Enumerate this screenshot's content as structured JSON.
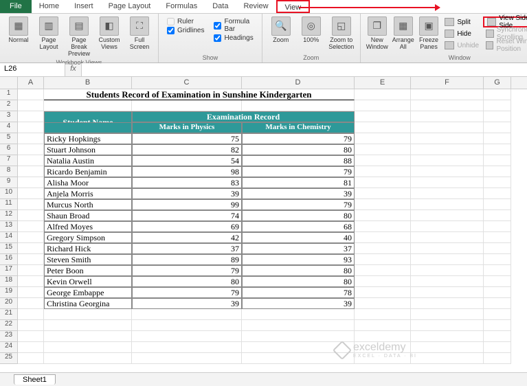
{
  "tabs": {
    "file": "File",
    "home": "Home",
    "insert": "Insert",
    "pagelayout": "Page Layout",
    "formulas": "Formulas",
    "data": "Data",
    "review": "Review",
    "view": "View"
  },
  "ribbon": {
    "views": {
      "normal": "Normal",
      "page": "Page Layout",
      "break": "Page Break Preview",
      "custom": "Custom Views",
      "full": "Full Screen",
      "group": "Workbook Views"
    },
    "show": {
      "ruler": "Ruler",
      "formulabar": "Formula Bar",
      "gridlines": "Gridlines",
      "headings": "Headings",
      "group": "Show"
    },
    "zoom": {
      "zoom": "Zoom",
      "p100": "100%",
      "sel": "Zoom to Selection",
      "group": "Zoom"
    },
    "window": {
      "new": "New Window",
      "arrange": "Arrange All",
      "freeze": "Freeze Panes",
      "split": "Split",
      "hide": "Hide",
      "unhide": "Unhide",
      "sidebyside": "View Side by Side",
      "sync": "Synchronous Scrolling",
      "reset": "Reset Window Position",
      "group": "Window"
    }
  },
  "namebox": "L26",
  "cols": [
    "A",
    "B",
    "C",
    "D",
    "E",
    "F",
    "G"
  ],
  "title": "Students Record of Examination in Sunshine Kindergarten",
  "headers": {
    "student": "Student Name",
    "exam": "Examination Record",
    "phys": "Marks in Physics",
    "chem": "Marks in Chemistry"
  },
  "students": [
    {
      "name": "Ricky Hopkings",
      "p": 75,
      "c": 79
    },
    {
      "name": "Stuart Johnson",
      "p": 82,
      "c": 80
    },
    {
      "name": "Natalia Austin",
      "p": 54,
      "c": 88
    },
    {
      "name": "Ricardo Benjamin",
      "p": 98,
      "c": 79
    },
    {
      "name": "Alisha Moor",
      "p": 83,
      "c": 81
    },
    {
      "name": "Anjela Morris",
      "p": 39,
      "c": 39
    },
    {
      "name": "Murcus North",
      "p": 99,
      "c": 79
    },
    {
      "name": "Shaun Broad",
      "p": 74,
      "c": 80
    },
    {
      "name": "Alfred Moyes",
      "p": 69,
      "c": 68
    },
    {
      "name": "Gregory Simpson",
      "p": 42,
      "c": 40
    },
    {
      "name": "Richard Hick",
      "p": 37,
      "c": 37
    },
    {
      "name": "Steven Smith",
      "p": 89,
      "c": 93
    },
    {
      "name": "Peter Boon",
      "p": 79,
      "c": 80
    },
    {
      "name": "Kevin Orwell",
      "p": 80,
      "c": 80
    },
    {
      "name": "George Embappe",
      "p": 79,
      "c": 78
    },
    {
      "name": "Christina Georgina",
      "p": 39,
      "c": 39
    }
  ],
  "sheet": "Sheet1",
  "watermark": {
    "name": "exceldemy",
    "sub": "EXCEL · DATA · BI"
  }
}
